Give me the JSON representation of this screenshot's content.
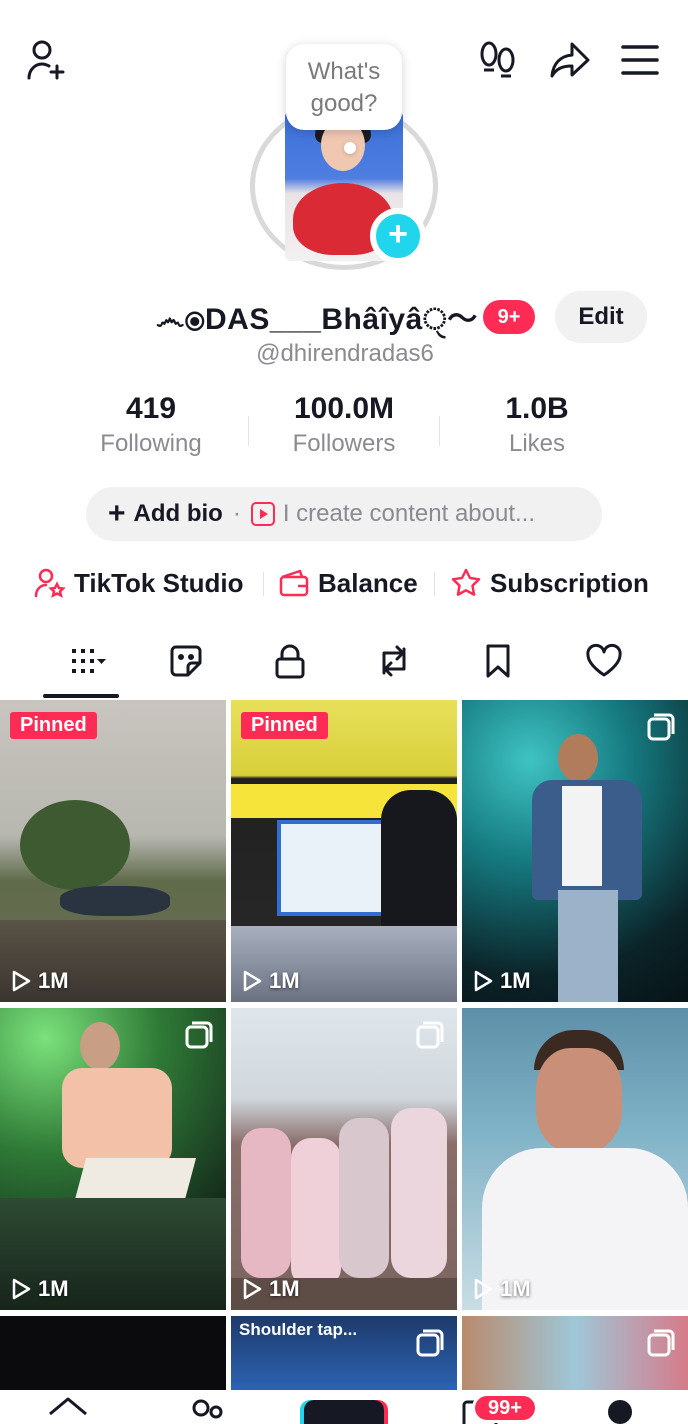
{
  "header": {
    "add_friend_icon": "person-plus-icon",
    "footprints_icon": "footprints-icon",
    "share_icon": "share-arrow-icon",
    "menu_icon": "hamburger-menu-icon"
  },
  "profile": {
    "bubble_text_1": "What's",
    "bubble_text_2": "good?",
    "display_name": "෴⦿DAS___Bhâîyâੑ〜",
    "notification_badge": "9+",
    "edit_label": "Edit",
    "username": "@dhirendradas6"
  },
  "stats": [
    {
      "value": "419",
      "label": "Following"
    },
    {
      "value": "100.0M",
      "label": "Followers"
    },
    {
      "value": "1.0B",
      "label": "Likes"
    }
  ],
  "bio": {
    "add_label": "Add bio",
    "separator": "·",
    "placeholder": "I create content about..."
  },
  "shortcuts": [
    {
      "label": "TikTok Studio",
      "icon": "studio-person-star-icon"
    },
    {
      "label": "Balance",
      "icon": "wallet-icon"
    },
    {
      "label": "Subscription",
      "icon": "subscription-star-icon"
    }
  ],
  "tabs": [
    {
      "icon": "videos-grid-icon",
      "active": true
    },
    {
      "icon": "sticker-icon"
    },
    {
      "icon": "lock-icon"
    },
    {
      "icon": "repost-icon"
    },
    {
      "icon": "bookmark-icon"
    },
    {
      "icon": "heart-icon"
    }
  ],
  "videos": [
    {
      "pinned": "Pinned",
      "views": "1M"
    },
    {
      "pinned": "Pinned",
      "views": "1M"
    },
    {
      "views": "1M",
      "multi": true
    },
    {
      "views": "1M",
      "multi": true
    },
    {
      "views": "1M",
      "multi": true
    },
    {
      "views": "1M"
    },
    {
      "caption": "Shoulder tap..."
    }
  ],
  "bottom_nav": {
    "inbox_badge": "99+"
  },
  "colors": {
    "accent_pink": "#fe2c55",
    "accent_cyan": "#20d5ec",
    "text_primary": "#161823",
    "text_secondary": "#8a8b91"
  }
}
